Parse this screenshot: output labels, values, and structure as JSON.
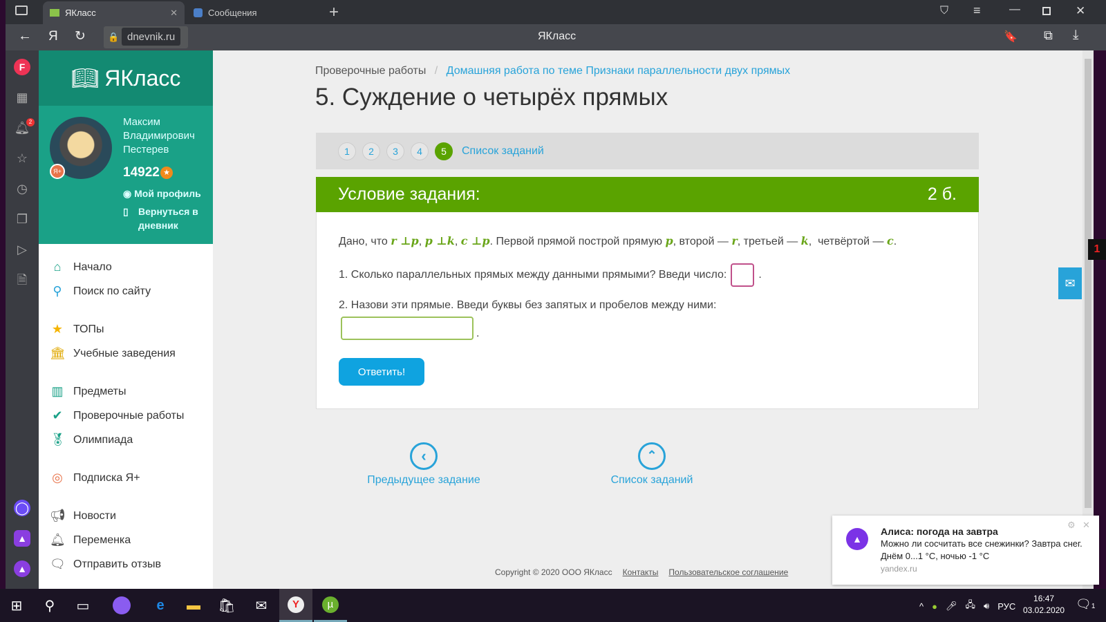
{
  "browser": {
    "tabs": [
      {
        "label": "ЯКласс"
      },
      {
        "label": "Сообщения"
      }
    ],
    "url": "dnevnik.ru",
    "page_title": "ЯКласс",
    "notif_badge": "2"
  },
  "sidebar": {
    "logo": "ЯКласс",
    "user": {
      "first": "Максим",
      "middle": "Владимирович",
      "last": "Пестерев",
      "points": "14922",
      "badge": "Я+"
    },
    "profile_link": "Мой профиль",
    "back_link": "Вернуться в дневник",
    "items": [
      {
        "label": "Начало"
      },
      {
        "label": "Поиск по сайту"
      },
      {
        "label": "ТОПы"
      },
      {
        "label": "Учебные заведения"
      },
      {
        "label": "Предметы"
      },
      {
        "label": "Проверочные работы"
      },
      {
        "label": "Олимпиада"
      },
      {
        "label": "Подписка Я+"
      },
      {
        "label": "Новости"
      },
      {
        "label": "Переменка"
      },
      {
        "label": "Отправить отзыв"
      }
    ]
  },
  "main": {
    "breadcrumb": [
      "Проверочные работы",
      "Домашняя работа по теме Признаки параллельности двух прямых"
    ],
    "title": "5. Суждение о четырёх прямых",
    "task_numbers": [
      "1",
      "2",
      "3",
      "4",
      "5"
    ],
    "current_task": "5",
    "task_list_link": "Список заданий",
    "condition_label": "Условие задания:",
    "points": "2 б.",
    "statement": {
      "t1": "Дано, что ",
      "m1": "r ⊥p",
      "s1": ", ",
      "m2": "p ⊥k",
      "s2": ", ",
      "m3": "c ⊥p",
      "t2": ". Первой прямой построй прямую ",
      "m4": "p",
      "t3": ", второй — ",
      "m5": "r",
      "t4": ", третьей — ",
      "m6": "k",
      "t5": ",  четвёртой — ",
      "m7": "c",
      "t6": "."
    },
    "q1": "1. Сколько параллельных прямых между данными прямыми? Введи число:",
    "q1_value": "",
    "q2": "2. Назови эти прямые. Введи буквы без запятых и пробелов между ними:",
    "q2_value": "",
    "submit": "Ответить!",
    "prev": "Предыдущее задание",
    "list": "Список заданий"
  },
  "footer": {
    "copyright": "Copyright © 2020 ООО ЯКласс",
    "contacts": "Контакты",
    "agreement": "Пользовательское соглашение"
  },
  "notification": {
    "title": "Алиса: погода на завтра",
    "line1": "Можно ли сосчитать все снежинки? Завтра снег.",
    "line2": "Днём 0...1 °C, ночью -1 °C",
    "source": "yandex.ru"
  },
  "taskbar": {
    "lang": "РУС",
    "time": "16:47",
    "date": "03.02.2020",
    "action_count": "1"
  }
}
